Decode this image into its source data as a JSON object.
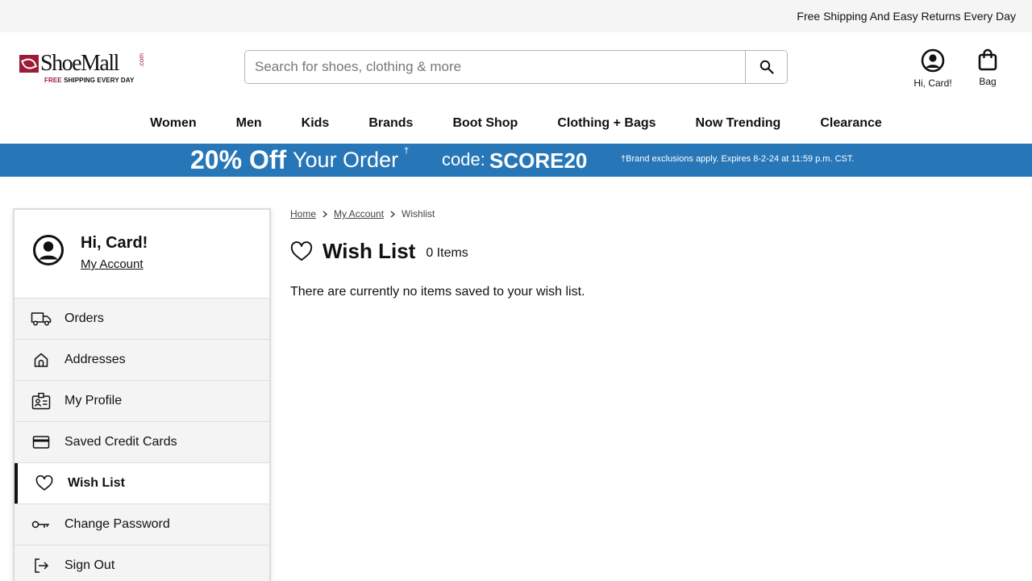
{
  "topbar": {
    "text": "Free Shipping And Easy Returns Every Day"
  },
  "logo": {
    "wordmark": "ShoeMall",
    "com": ".com",
    "tag_free": "FREE",
    "tag_rest": " SHIPPING EVERY DAY"
  },
  "search": {
    "placeholder": "Search for shoes, clothing & more",
    "value": ""
  },
  "header": {
    "account_label": "Hi, Card!",
    "bag_label": "Bag"
  },
  "nav": [
    "Women",
    "Men",
    "Kids",
    "Brands",
    "Boot Shop",
    "Clothing + Bags",
    "Now Trending",
    "Clearance"
  ],
  "promo": {
    "headline_bold": "20% Off",
    "headline_rest": "Your Order",
    "dagger": "†",
    "code_label": "code:",
    "code": "SCORE20",
    "disclaimer": "†Brand exclusions apply. Expires 8-2-24 at 11:59 p.m. CST."
  },
  "sidebar": {
    "greeting": "Hi, Card!",
    "account_link": "My Account",
    "items": [
      {
        "label": "Orders",
        "icon": "truck-icon"
      },
      {
        "label": "Addresses",
        "icon": "home-icon"
      },
      {
        "label": "My Profile",
        "icon": "id-badge-icon"
      },
      {
        "label": "Saved Credit Cards",
        "icon": "credit-card-icon"
      },
      {
        "label": "Wish List",
        "icon": "heart-icon",
        "active": true
      },
      {
        "label": "Change Password",
        "icon": "key-icon"
      },
      {
        "label": "Sign Out",
        "icon": "sign-out-icon"
      }
    ]
  },
  "breadcrumb": {
    "home": "Home",
    "account": "My Account",
    "current": "Wishlist"
  },
  "wishlist": {
    "title": "Wish List",
    "count": "0 Items",
    "empty_message": "There are currently no items saved to your wish list."
  },
  "colors": {
    "brand": "#9c1b35",
    "promo_bg": "#2776b7",
    "topbar_bg": "#f5f5f5"
  }
}
